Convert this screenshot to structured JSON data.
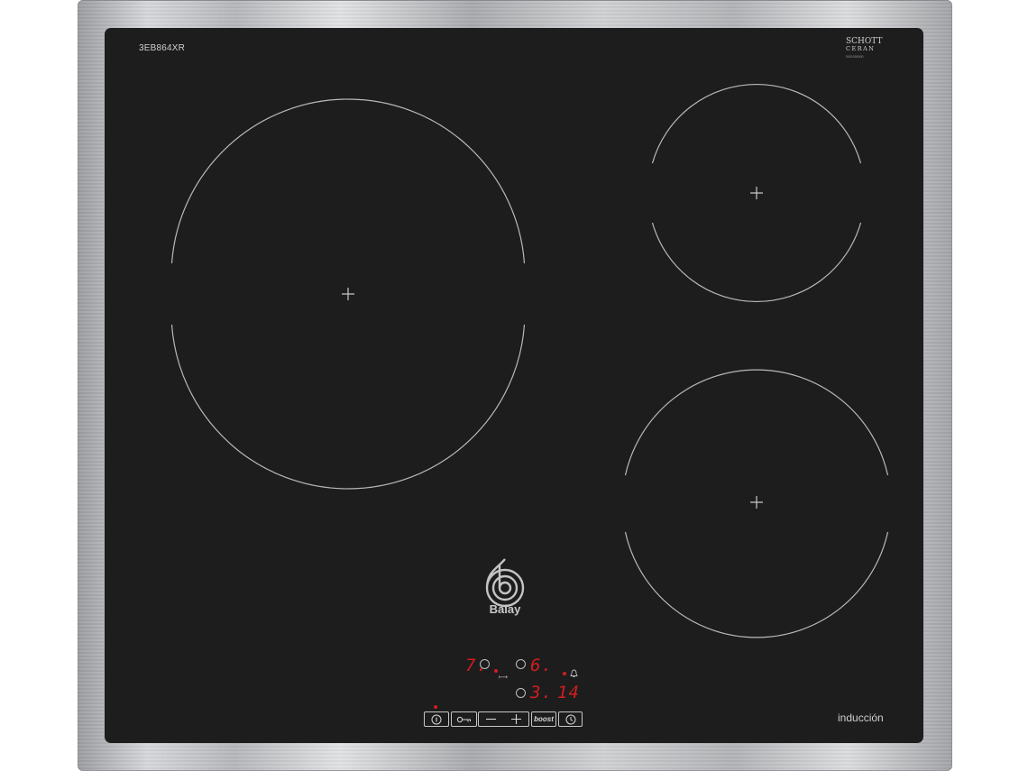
{
  "hob": {
    "model": "3EB864XR",
    "brand": "Balay",
    "glass_brand_line1": "SCHOTT",
    "glass_brand_line2": "CERAN",
    "glass_brand_line3": "0001000000",
    "type_label": "inducción"
  },
  "display": {
    "zone_left": "7.",
    "zone_top_right": "6.",
    "zone_bottom_right": "3.",
    "timer": "14"
  },
  "controls": {
    "boost_label": "boost"
  },
  "colors": {
    "glass": "#1d1d1d",
    "display_red": "#d11e1e",
    "printed": "#cfcfcf"
  }
}
